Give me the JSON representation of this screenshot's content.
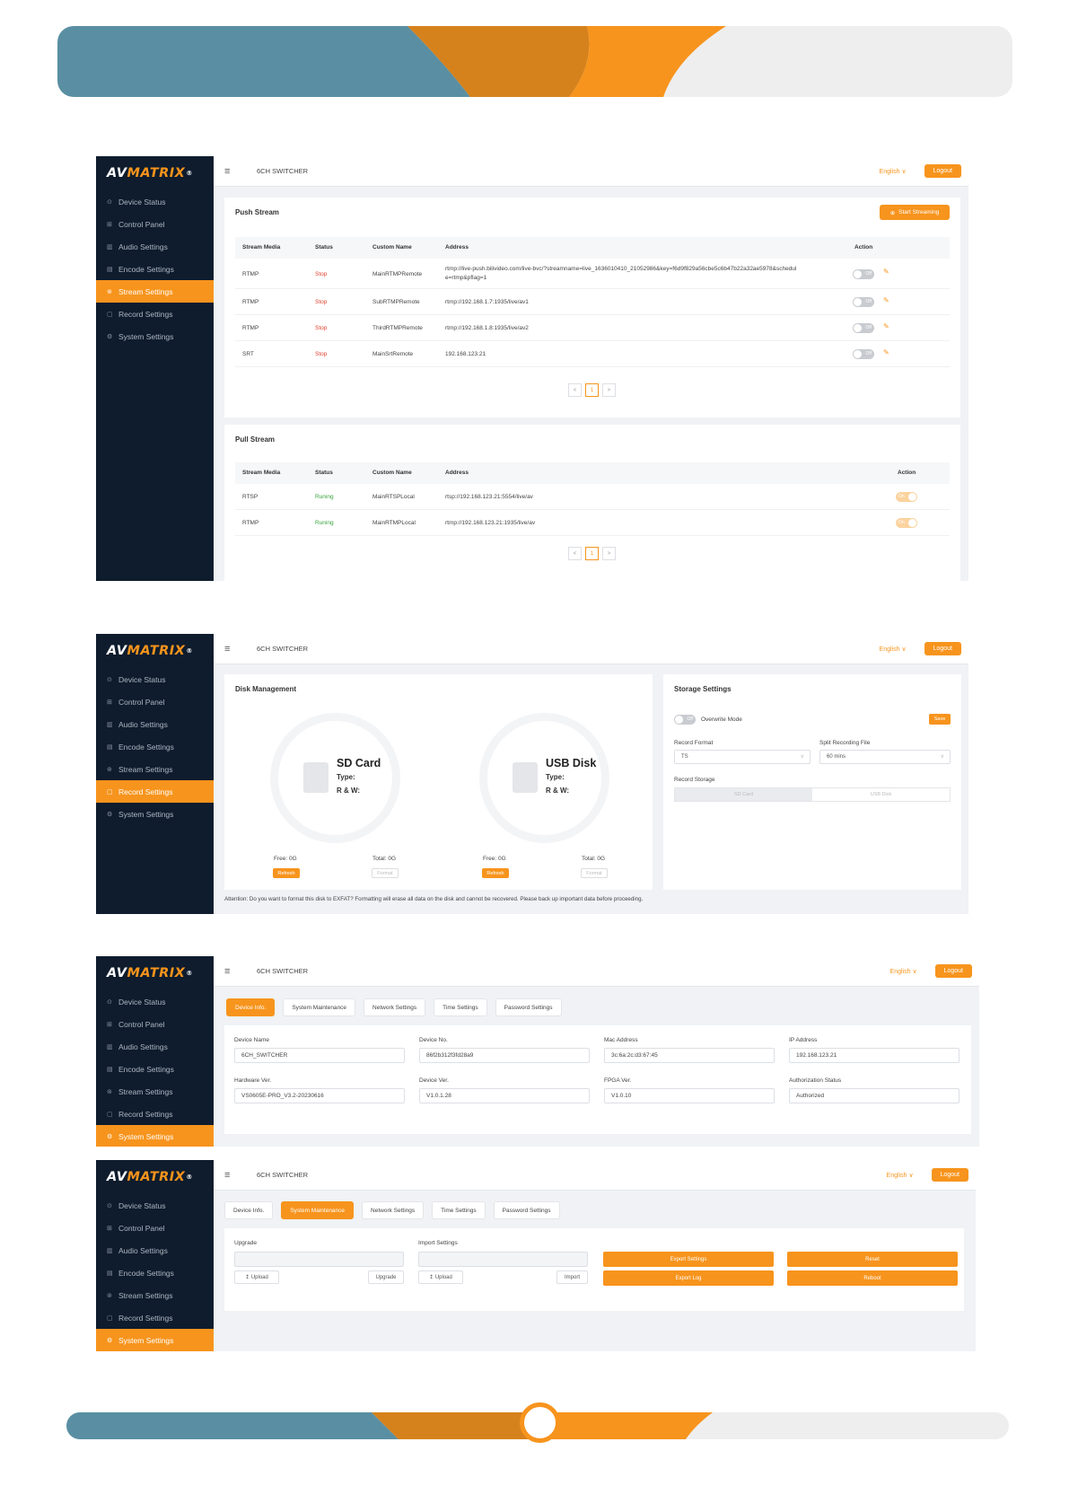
{
  "brand": {
    "name_part1": "AV",
    "name_part2": "MATRIX",
    "reg_mark": "®",
    "accent_color": "#f7941d",
    "sidebar_color": "#0e1c2d"
  },
  "nav_items": [
    "Device Status",
    "Control Panel",
    "Audio Settings",
    "Encode Settings",
    "Stream Settings",
    "Record Settings",
    "System Settings"
  ],
  "topbar": {
    "menu_icon": "≡",
    "device_title": "6CH SWITCHER",
    "language": "English ∨",
    "logout": "Logout"
  },
  "stream_page": {
    "push": {
      "title": "Push Stream",
      "start_button": "Start Streaming",
      "headers": [
        "Stream Media",
        "Status",
        "Custom Name",
        "Address",
        "Action"
      ],
      "rows": [
        {
          "media": "RTMP",
          "status": "Stop",
          "name": "MainRTMPRemote",
          "address": "rtmp://live-push.bilivideo.com/live-bvc/?streamname=live_1636010410_21052986&key=f6d9f829a56cbe5c6b47b22a32ae5978&schedul",
          "address2": "e=rtmp&pflag=1",
          "toggle": "Off"
        },
        {
          "media": "RTMP",
          "status": "Stop",
          "name": "SubRTMPRemote",
          "address": "rtmp://192.168.1.7:1935/live/av1",
          "toggle": "Off"
        },
        {
          "media": "RTMP",
          "status": "Stop",
          "name": "ThirdRTMPRemote",
          "address": "rtmp://192.168.1.8:1935/live/av2",
          "toggle": "Off"
        },
        {
          "media": "SRT",
          "status": "Stop",
          "name": "MainSrtRemote",
          "address": "192.168.123.21",
          "toggle": "Off"
        }
      ],
      "page": "1"
    },
    "pull": {
      "title": "Pull Stream",
      "headers": [
        "Stream Media",
        "Status",
        "Custom Name",
        "Address",
        "Action"
      ],
      "rows": [
        {
          "media": "RTSP",
          "status": "Runing",
          "name": "MainRTSPLocal",
          "address": "rtsp://192.168.123.21:5554/live/av",
          "toggle": "On"
        },
        {
          "media": "RTMP",
          "status": "Runing",
          "name": "MainRTMPLocal",
          "address": "rtmp://192.168.123.21:1935/live/av",
          "toggle": "On"
        }
      ],
      "page": "1"
    }
  },
  "record_page": {
    "disk_title": "Disk Management",
    "disks": [
      {
        "name": "SD Card",
        "type_label": "Type:",
        "rw_label": "R & W:",
        "free": "Free: 0G",
        "total": "Total: 0G",
        "refresh": "Refresh",
        "format": "Format"
      },
      {
        "name": "USB Disk",
        "type_label": "Type:",
        "rw_label": "R & W:",
        "free": "Free: 0G",
        "total": "Total: 0G",
        "refresh": "Refresh",
        "format": "Format"
      }
    ],
    "storage": {
      "title": "Storage Settings",
      "overwrite_toggle": "Off",
      "overwrite_label": "Overwrite Mode",
      "save": "Save",
      "format_label": "Record Format",
      "format_value": "TS",
      "split_label": "Split Recording File",
      "split_value": "60 mins",
      "storage_label": "Record Storage",
      "storage_options": [
        "SD Card",
        "USB Disk"
      ]
    },
    "attention": "Attention: Do you want to format this disk to EXFAT? Formatting will erase all data on the disk and cannot be recovered. Please back up important data before proceeding."
  },
  "system_tabs": [
    "Device Info.",
    "System Maintenance",
    "Network Settings",
    "Time Settings",
    "Password Settings"
  ],
  "device_info": {
    "fields": [
      {
        "label": "Device Name",
        "value": "6CH_SWITCHER"
      },
      {
        "label": "Device No.",
        "value": "86f2b312f3fd28a9"
      },
      {
        "label": "Mac Address",
        "value": "3c:6a:2c:d3:67:45"
      },
      {
        "label": "IP Address",
        "value": "192.168.123.21"
      },
      {
        "label": "Hardware Ver.",
        "value": "VS0605E-PRO_V3.2-20230616"
      },
      {
        "label": "Device Ver.",
        "value": "V1.0.1.28"
      },
      {
        "label": "FPGA Ver.",
        "value": "V1.0.10"
      },
      {
        "label": "Authorization Status",
        "value": "Authorized"
      }
    ]
  },
  "maintenance": {
    "upgrade_label": "Upgrade",
    "import_label": "Import Settings",
    "upload": "↥ Upload",
    "upgrade_btn": "Upgrade",
    "import_btn": "Import",
    "export_settings": "Export Settings",
    "reset": "Reset",
    "export_log": "Export Log",
    "reboot": "Reboot"
  }
}
